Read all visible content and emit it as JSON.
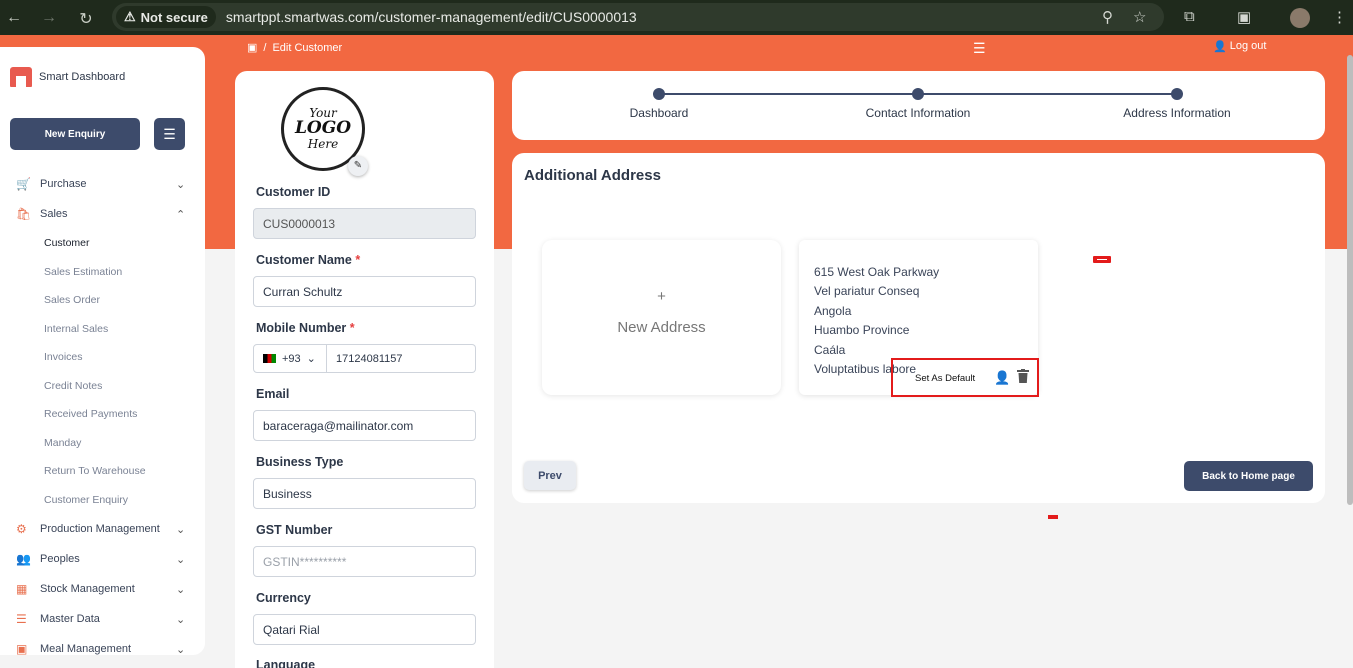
{
  "browser": {
    "security_label": "Not secure",
    "url": "smartppt.smartwas.com/customer-management/edit/CUS0000013"
  },
  "sidebar": {
    "brand": "Smart Dashboard",
    "new_enquiry": "New Enquiry",
    "menu": [
      {
        "label": "Purchase",
        "icon": "cart-icon",
        "expanded": false
      },
      {
        "label": "Sales",
        "icon": "bag-icon",
        "expanded": true
      }
    ],
    "sales_sub": [
      "Customer",
      "Sales Estimation",
      "Sales Order",
      "Internal Sales",
      "Invoices",
      "Credit Notes",
      "Received Payments",
      "Manday",
      "Return To Warehouse",
      "Customer Enquiry"
    ],
    "menu_after": [
      {
        "label": "Production Management",
        "icon": "gear-icon"
      },
      {
        "label": "Peoples",
        "icon": "people-icon"
      },
      {
        "label": "Stock Management",
        "icon": "box-icon"
      },
      {
        "label": "Master Data",
        "icon": "database-icon"
      },
      {
        "label": "Meal Management",
        "icon": "meal-icon"
      }
    ]
  },
  "header": {
    "breadcrumb": "Edit Customer",
    "breadcrumb_sep": "/",
    "logout": "Log out"
  },
  "form": {
    "customer_id_label": "Customer ID",
    "customer_id_value": "CUS0000013",
    "customer_name_label": "Customer Name",
    "customer_name_value": "Curran Schultz",
    "mobile_label": "Mobile Number",
    "country_code": "+93",
    "mobile_value": "17124081157",
    "email_label": "Email",
    "email_value": "baraceraga@mailinator.com",
    "business_type_label": "Business Type",
    "business_type_value": "Business",
    "gst_label": "GST Number",
    "gst_placeholder": "GSTIN**********",
    "currency_label": "Currency",
    "currency_value": "Qatari Rial",
    "language_label": "Language",
    "required_mark": "*",
    "logo_text": [
      "Your",
      "LOGO",
      "Here"
    ]
  },
  "stepper": {
    "steps": [
      "Dashboard",
      "Contact Information",
      "Address Information"
    ]
  },
  "address": {
    "title": "Additional Address",
    "new_plus": "+",
    "new_label": "New Address",
    "lines": [
      "615 West Oak Parkway",
      "Vel pariatur Conseq",
      "Angola",
      "Huambo Province",
      "Caála",
      "Voluptatibus labore"
    ],
    "set_default": "Set As Default",
    "prev": "Prev",
    "back_home": "Back to Home page"
  },
  "colors": {
    "accent": "#f26841",
    "primary": "#3d4b6b",
    "highlight": "#e31b1b"
  }
}
